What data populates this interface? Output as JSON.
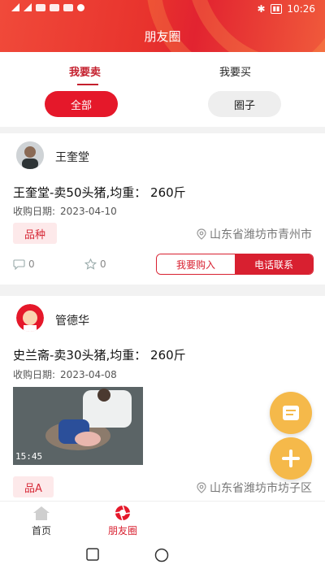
{
  "status": {
    "time": "10:26"
  },
  "header": {
    "title": "朋友圈"
  },
  "tabs": {
    "sell": "我要卖",
    "buy": "我要买"
  },
  "chips": {
    "all": "全部",
    "circle": "圈子"
  },
  "posts": [
    {
      "user": "王奎堂",
      "title": "王奎堂-卖50头猪,均重：  260斤",
      "date_label": "收购日期:",
      "date": "2023-04-10",
      "tag": "品种",
      "location": "山东省潍坊市青州市",
      "comments": "0",
      "likes": "0",
      "buy_button": "我要购入",
      "call_button": "电话联系"
    },
    {
      "user": "管德华",
      "title": "史兰斋-卖30头猪,均重：  260斤",
      "date_label": "收购日期:",
      "date": "2023-04-08",
      "photo_timestamp": "15:45",
      "tag": "品A",
      "location": "山东省潍坊市坊子区"
    }
  ],
  "bottom_nav": {
    "home": "首页",
    "moments": "朋友圈"
  },
  "colors": {
    "accent": "#d82030",
    "fab": "#f5b94a"
  }
}
